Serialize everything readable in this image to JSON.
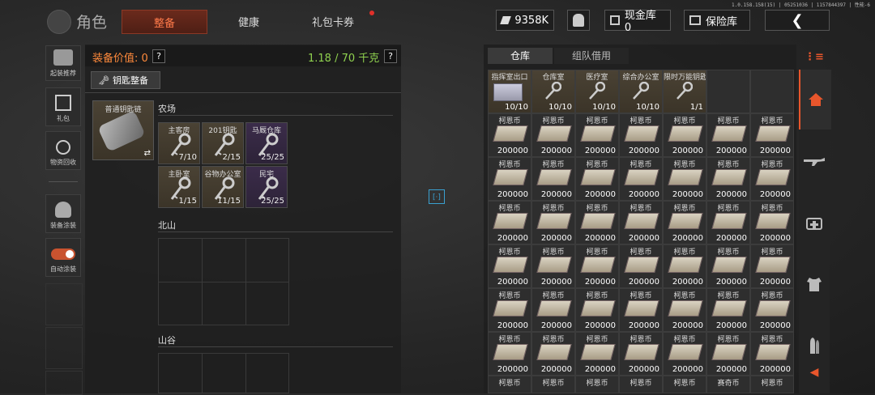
{
  "version": "1.0.158.158(15) | 05251036 | 1157844397 | 性能-6",
  "header": {
    "title": "角色",
    "tabs": [
      {
        "label": "整备",
        "active": true
      },
      {
        "label": "健康",
        "active": false
      },
      {
        "label": "礼包卡券",
        "active": false
      }
    ],
    "currency": "9358K",
    "cash_vault": "现金库 0",
    "safe_box": "保险库"
  },
  "sidebar": {
    "items": [
      {
        "label": "起装推荐"
      },
      {
        "label": "礼包"
      },
      {
        "label": "物资回收"
      },
      {
        "label": "装备涂装"
      },
      {
        "label": "自动涂装"
      }
    ]
  },
  "loadout": {
    "value_label": "装备价值: 0",
    "help": "?",
    "weight": "1.18 / 70 千克",
    "key_button": "钥匙整备",
    "keychain_name": "普通钥匙链",
    "swap_icon": "⇄",
    "sections": [
      {
        "name": "农场",
        "keys": [
          {
            "name": "主客房",
            "count": "7/10",
            "style": "key"
          },
          {
            "name": "201钥匙",
            "count": "2/15",
            "style": "key"
          },
          {
            "name": "马厩仓库",
            "count": "25/25",
            "style": "purple"
          },
          {
            "name": "主卧室",
            "count": "1/15",
            "style": "key"
          },
          {
            "name": "谷物办公室",
            "count": "11/15",
            "style": "key"
          },
          {
            "name": "民宅",
            "count": "25/25",
            "style": "purple"
          }
        ]
      },
      {
        "name": "北山",
        "keys": []
      },
      {
        "name": "山谷",
        "keys": []
      }
    ]
  },
  "warehouse": {
    "tabs": [
      {
        "label": "仓库",
        "active": true
      },
      {
        "label": "组队借用",
        "active": false
      }
    ],
    "top_row": [
      {
        "name": "指挥室出口",
        "count": "10/10",
        "kind": "card"
      },
      {
        "name": "仓库室",
        "count": "10/10",
        "kind": "key"
      },
      {
        "name": "医疗室",
        "count": "10/10",
        "kind": "key"
      },
      {
        "name": "综合办公室",
        "count": "10/10",
        "kind": "key"
      },
      {
        "name": "限时万能钥匙",
        "count": "1/1",
        "kind": "key"
      }
    ],
    "money_name": "柯恩币",
    "money_count": "200000",
    "money_rows": 6,
    "money_cols": 7,
    "partial_row": [
      "柯恩币",
      "柯恩币",
      "柯恩币",
      "柯恩币",
      "柯恩币",
      "赛奇币",
      "柯恩币"
    ]
  },
  "rightnav": {
    "items": [
      "home-icon",
      "rifle-icon",
      "medkit-icon",
      "armor-icon",
      "ammo-icon"
    ],
    "active": "home-icon"
  },
  "center_bracket": "[·]",
  "colors": {
    "accent": "#e8562c",
    "weight_green": "#8fd14f",
    "value_orange": "#ff8a3c"
  }
}
